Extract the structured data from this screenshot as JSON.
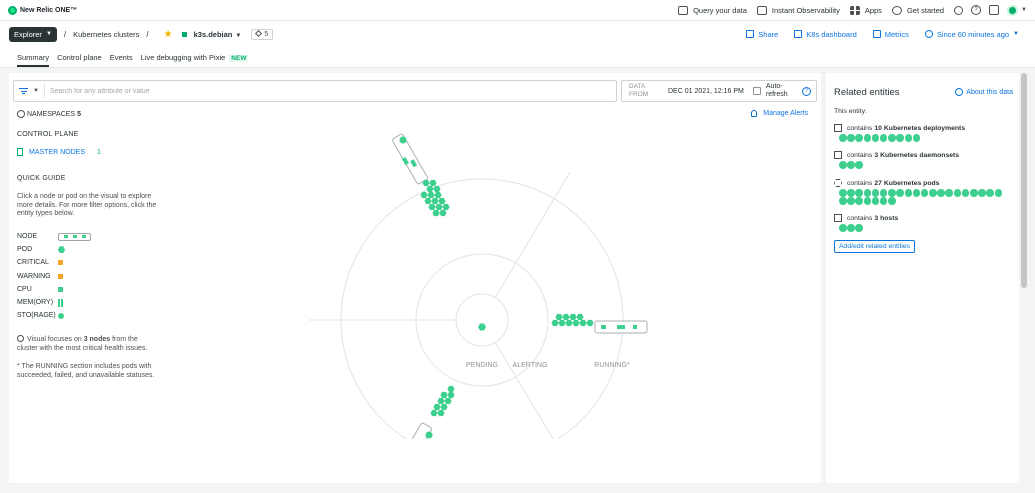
{
  "app": {
    "brand": "New Relic ONE™"
  },
  "topnav": {
    "query": "Query your data",
    "observability": "Instant Observability",
    "apps": "Apps",
    "get_started": "Get started"
  },
  "breadcrumb": {
    "explorer": "Explorer",
    "sep": "/",
    "clusters": "Kubernetes clusters",
    "entity": "k3s.debian",
    "tag_count": "5"
  },
  "actions": {
    "share": "Share",
    "k8s": "K8s dashboard",
    "metrics": "Metrics",
    "time": "Since 60 minutes ago"
  },
  "tabs": [
    {
      "label": "Summary"
    },
    {
      "label": "Control plane"
    },
    {
      "label": "Events"
    },
    {
      "label": "Live debugging with Pixie",
      "badge": "NEW"
    }
  ],
  "filter": {
    "placeholder": "Search for any attribute or value"
  },
  "date": {
    "label": "DATA FROM",
    "value": "DEC 01 2021, 12:16 PM",
    "auto_refresh": "Auto-refresh"
  },
  "namespaces": {
    "label": "NAMESPACES",
    "count": "5"
  },
  "manage_alerts": "Manage Alerts",
  "control_plane": {
    "title": "CONTROL PLANE",
    "master_nodes": "MASTER NODES",
    "master_count": "1"
  },
  "quick_guide": {
    "title": "QUICK GUIDE",
    "text": "Click a node or pod on the visual to explore more details. For more filter options, click the entity types below.",
    "legend": [
      {
        "label": "NODE",
        "marker": "node"
      },
      {
        "label": "POD",
        "marker": "pod"
      },
      {
        "label": "CRITICAL",
        "marker": "critical",
        "color": "#f5a623"
      },
      {
        "label": "WARNING",
        "marker": "warning",
        "color": "#f5a623"
      },
      {
        "label": "CPU",
        "marker": "cpu",
        "color": "#3ccf8e"
      },
      {
        "label": "MEM(ORY)",
        "marker": "mem"
      },
      {
        "label": "STO(RAGE)",
        "marker": "sto"
      }
    ]
  },
  "notes": {
    "focus_pre": "Visual focuses on ",
    "focus_bold": "3 nodes",
    "focus_post": " from the cluster with the most critical health issues.",
    "running": "* The RUNNING section includes pods with succeeded, failed, and unavailable statuses."
  },
  "viz": {
    "pending": "PENDING",
    "alerting": "ALERTING",
    "running": "RUNNING*"
  },
  "related": {
    "title": "Related entities",
    "about": "About this data",
    "this_entity": "This entity:",
    "contains": "contains",
    "items": [
      {
        "count": "10",
        "label": "Kubernetes deployments",
        "icon": "deployment-icon",
        "n": 10
      },
      {
        "count": "3",
        "label": "Kubernetes daemonsets",
        "icon": "daemonset-icon",
        "n": 3
      },
      {
        "count": "27",
        "label": "Kubernetes pods",
        "icon": "pod-icon",
        "n": 27
      },
      {
        "count": "3",
        "label": "hosts",
        "icon": "host-icon",
        "n": 3
      }
    ],
    "add_edit": "Add/edit related entities"
  },
  "colors": {
    "healthy": "#3ccf8e",
    "warning": "#f5a623",
    "link": "#0c74df"
  }
}
